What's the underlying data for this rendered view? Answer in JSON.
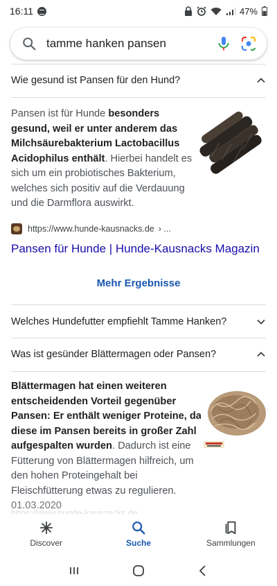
{
  "status": {
    "time": "16:11",
    "battery": "47%"
  },
  "search": {
    "query": "tamme hanken pansen"
  },
  "faq1": {
    "question": "Wie gesund ist Pansen für den Hund?",
    "answer_html": "Pansen ist für Hunde <b>besonders gesund, weil er unter anderem das Milchsäurebakterium Lactobacillus Acidophilus enthält</b>. Hierbei handelt es sich um ein probiotisches Bakterium, welches sich positiv auf die Verdauung und die Darmflora auswirkt.",
    "source_url": "https://www.hunde-kausnacks.de",
    "source_more": "› ...",
    "link_title": "Pansen für Hunde | Hunde-Kausnacks Magazin"
  },
  "more_results": "Mehr Ergebnisse",
  "faq2": {
    "question": "Welches Hundefutter empfiehlt Tamme Hanken?"
  },
  "faq3": {
    "question": "Was ist gesünder Blättermagen oder Pansen?",
    "answer_html": "<b>Blättermagen hat einen weiteren entscheidenden Vorteil gegenüber Pansen: Er enthält weniger Proteine, da diese im Pansen bereits in großer Zahl aufgespalten wurden</b>. Dadurch ist eine Fütterung von Blättermagen hilfreich, um den hohen Proteingehalt bei Fleischfütterung etwas zu regulieren.",
    "date": "01.03.2020",
    "faded_source": "https://www.hunde-kausnacks.de"
  },
  "bottom_nav": {
    "items": [
      {
        "label": "Discover",
        "icon": "asterisk-icon"
      },
      {
        "label": "Suche",
        "icon": "search-icon"
      },
      {
        "label": "Sammlungen",
        "icon": "collections-icon"
      }
    ]
  },
  "colors": {
    "link": "#1a0dab",
    "accent": "#1a57b0"
  }
}
